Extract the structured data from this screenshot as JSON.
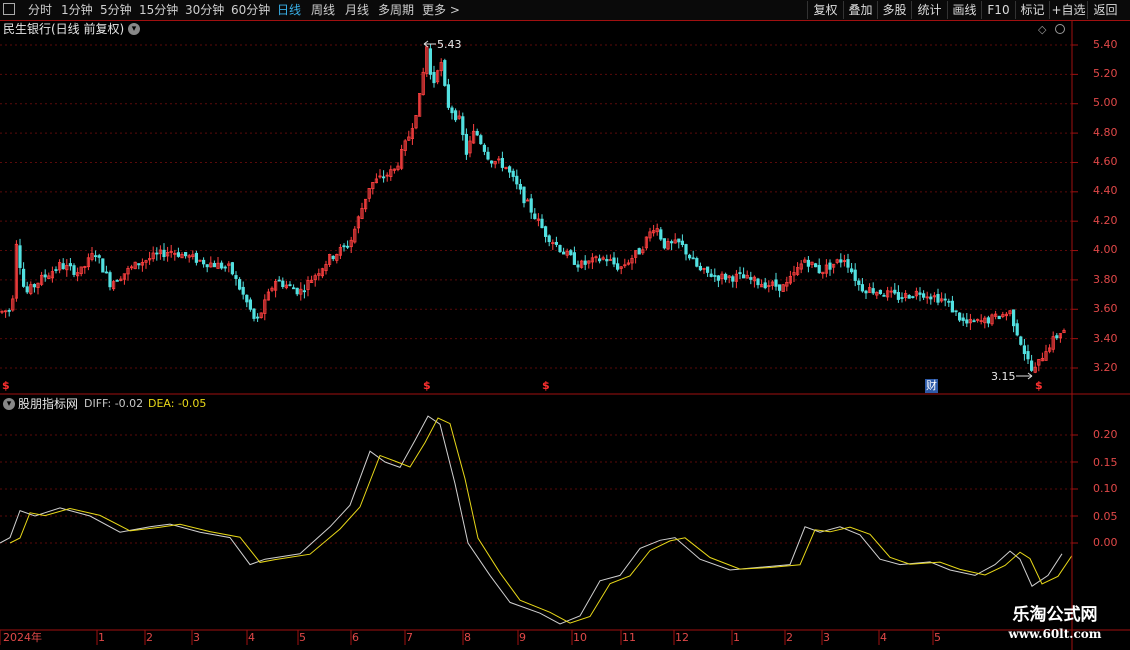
{
  "toolbar": {
    "periods": [
      "分时",
      "1分钟",
      "5分钟",
      "15分钟",
      "30分钟",
      "60分钟",
      "日线",
      "周线",
      "月线",
      "多周期",
      "更多 >"
    ],
    "active_period": "日线",
    "buttons": [
      "复权",
      "叠加",
      "多股",
      "统计",
      "画线",
      "F10",
      "标记",
      "+自选",
      "返回"
    ]
  },
  "main_chart": {
    "title": "民生银行(日线 前复权)",
    "y_ticks": [
      "5.40",
      "5.20",
      "5.00",
      "4.80",
      "4.60",
      "4.40",
      "4.20",
      "4.00",
      "3.80",
      "3.60",
      "3.40",
      "3.20"
    ],
    "high_label": "5.43",
    "low_label": "3.15",
    "event_marker": "$",
    "finance_badge": "财"
  },
  "indicator": {
    "name": "股朋指标网",
    "diff_label": "DIFF: -0.02",
    "dea_label": "DEA: -0.05",
    "y_ticks": [
      "0.20",
      "0.15",
      "0.10",
      "0.05",
      "0.00"
    ]
  },
  "x_axis": {
    "labels": [
      "2024年",
      "1",
      "2",
      "3",
      "4",
      "5",
      "6",
      "7",
      "8",
      "9",
      "10",
      "11",
      "12",
      "1",
      "2",
      "3",
      "4",
      "5"
    ]
  },
  "watermark": {
    "title": "乐淘公式网",
    "url": "www.60lt.com"
  },
  "colors": {
    "up": "#ff4040",
    "down": "#52e0e0",
    "diff": "#d0d0d0",
    "dea": "#e8d818",
    "axis": "#a01010",
    "active_period": "#39b0e8"
  }
}
